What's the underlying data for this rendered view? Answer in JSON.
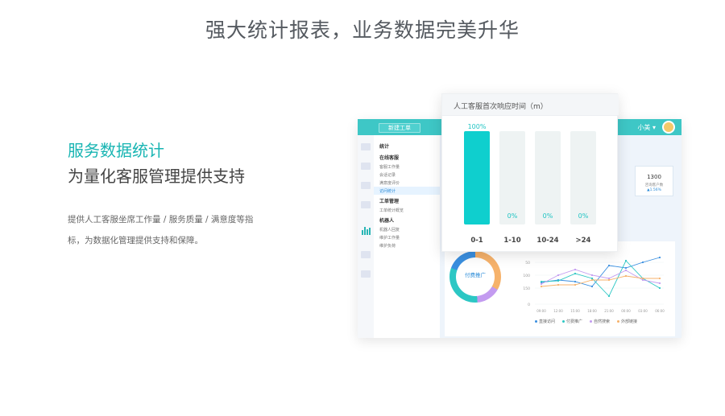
{
  "hero": {
    "title": "强大统计报表，业务数据完美升华"
  },
  "left": {
    "heading_accent": "服务数据统计",
    "heading_main": "为量化客服管理提供支持",
    "desc_line1": "提供人工客服坐席工作量 / 服务质量 / 满意度等指",
    "desc_line2": "标，为数据化管理提供支持和保障。"
  },
  "app": {
    "new_ticket_button": "新建工单",
    "user_name": "小美 ▾",
    "menu": [
      {
        "type": "group",
        "label": "统计"
      },
      {
        "type": "group",
        "label": "在线客服"
      },
      {
        "type": "item",
        "label": "客服工作量"
      },
      {
        "type": "item",
        "label": "会话记录"
      },
      {
        "type": "item",
        "label": "满意度评价"
      },
      {
        "type": "item",
        "label": "访问统计",
        "active": true
      },
      {
        "type": "group",
        "label": "工单管理"
      },
      {
        "type": "item",
        "label": "工单统计概览"
      },
      {
        "type": "group",
        "label": "机器人"
      },
      {
        "type": "item",
        "label": "机器人回复"
      },
      {
        "type": "item",
        "label": "维护工作量"
      },
      {
        "type": "item",
        "label": "维护负荷"
      }
    ],
    "cards": [
      {
        "num": "1300",
        "label": "咨询客户数",
        "pct": "▲1.56%"
      }
    ],
    "card_partial_num": "00",
    "donut_label": "付费推广",
    "line_chart": {
      "y_ticks": [
        "50",
        "100",
        "150",
        "0"
      ],
      "x_ticks": [
        "09:00",
        "12:00",
        "15:00",
        "18:00",
        "21:00",
        "00:00",
        "03:00",
        "06:00"
      ]
    },
    "legend": [
      {
        "label": "直接访问",
        "color": "#3a8fe0"
      },
      {
        "label": "付费推广",
        "color": "#2cc7c4"
      },
      {
        "label": "自然搜索",
        "color": "#c39bf0"
      },
      {
        "label": "外部链接",
        "color": "#f6b26b"
      }
    ]
  },
  "chart_data": {
    "type": "bar",
    "title": "人工客服首次响应时间（m）",
    "categories": [
      "0-1",
      "1-10",
      "10-24",
      ">24"
    ],
    "values": [
      100,
      0,
      0,
      0
    ],
    "value_labels": [
      "100%",
      "0%",
      "0%",
      "0%"
    ],
    "ylim": [
      0,
      100
    ],
    "colors": {
      "bar": "#0fcfce",
      "track": "#eef3f3"
    }
  }
}
